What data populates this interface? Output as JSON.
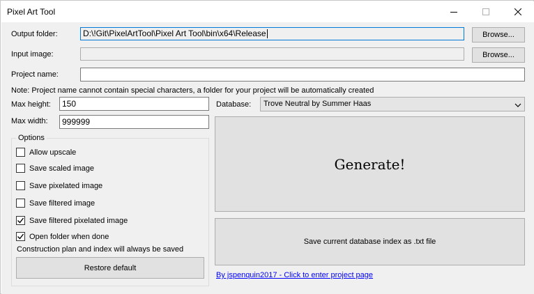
{
  "window": {
    "title": "Pixel Art Tool",
    "minimize_icon": "minimize-icon",
    "maximize_icon": "maximize-icon",
    "close_icon": "close-icon"
  },
  "output_folder": {
    "label": "Output folder:",
    "value": "D:\\!Git\\PixelArtTool\\Pixel Art Tool\\bin\\x64\\Release",
    "browse_label": "Browse..."
  },
  "input_image": {
    "label": "Input image:",
    "value": "",
    "browse_label": "Browse..."
  },
  "project_name": {
    "label": "Project name:",
    "value": ""
  },
  "note": "Note: Project name cannot contain special characters, a folder for your project will be automatically created",
  "max_height": {
    "label": "Max height:",
    "value": "150"
  },
  "max_width": {
    "label": "Max width:",
    "value": "999999"
  },
  "database": {
    "label": "Database:",
    "selected": "Trove Neutral by Summer Haas"
  },
  "options": {
    "title": "Options",
    "items": [
      {
        "label": "Allow upscale",
        "checked": false
      },
      {
        "label": "Save scaled image",
        "checked": false
      },
      {
        "label": "Save pixelated image",
        "checked": false
      },
      {
        "label": "Save filtered image",
        "checked": false
      },
      {
        "label": "Save filtered pixelated image",
        "checked": true
      },
      {
        "label": "Open folder when done",
        "checked": true
      }
    ],
    "footer_note": "Construction plan and index will always be saved",
    "restore_label": "Restore default"
  },
  "generate_label": "Generate!",
  "save_index_label": "Save current database index as .txt file",
  "footer_link": "By jspenquin2017 - Click to enter project page"
}
